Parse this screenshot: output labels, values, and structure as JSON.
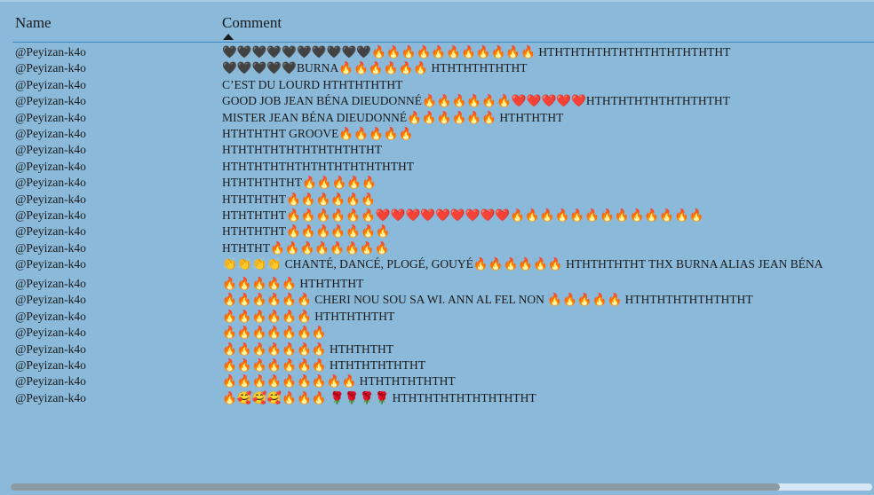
{
  "table": {
    "columns": {
      "name": "Name",
      "comment": "Comment"
    },
    "sort_indicator": "ascending",
    "rows": [
      {
        "name": "@Peyizan-k4o",
        "comment": "🖤🖤🖤🖤🖤🖤🖤🖤🖤🖤🔥🔥🔥🔥🔥🔥🔥🔥🔥🔥🔥 HTHTHTHTHTHTHTHTHTHTHTHT"
      },
      {
        "name": "@Peyizan-k4o",
        "comment": "🖤🖤🖤🖤🖤BURNA🔥🔥🔥🔥🔥🔥 HTHTHTHTHTHT"
      },
      {
        "name": "@Peyizan-k4o",
        "comment": "C’EST DU LOURD HTHTHTHTHT"
      },
      {
        "name": "@Peyizan-k4o",
        "comment": "GOOD JOB JEAN BÉNA DIEUDONNÉ🔥🔥🔥🔥🔥🔥❤️❤️❤️❤️❤️HTHTHTHTHTHTHTHTHT"
      },
      {
        "name": "@Peyizan-k4o",
        "comment": "MISTER JEAN BÉNA DIEUDONNÉ🔥🔥🔥🔥🔥🔥 HTHTHTHT"
      },
      {
        "name": "@Peyizan-k4o",
        "comment": "HTHTHTHT GROOVE🔥🔥🔥🔥🔥"
      },
      {
        "name": "@Peyizan-k4o",
        "comment": "HTHTHTHTHTHTHTHTHTHT"
      },
      {
        "name": "@Peyizan-k4o",
        "comment": "HTHTHTHTHTHTHTHTHTHTHTHT"
      },
      {
        "name": "@Peyizan-k4o",
        "comment": "HTHTHTHTHT🔥🔥🔥🔥🔥"
      },
      {
        "name": "@Peyizan-k4o",
        "comment": "HTHTHTHT🔥🔥🔥🔥🔥🔥"
      },
      {
        "name": "@Peyizan-k4o",
        "comment": "HTHTHTHT🔥🔥🔥🔥🔥🔥❤️❤️❤️❤️❤️❤️❤️❤️❤️🔥🔥🔥🔥🔥🔥🔥🔥🔥🔥🔥🔥🔥"
      },
      {
        "name": "@Peyizan-k4o",
        "comment": "HTHTHTHT🔥🔥🔥🔥🔥🔥🔥"
      },
      {
        "name": "@Peyizan-k4o",
        "comment": "HTHTHT🔥🔥🔥🔥🔥🔥🔥🔥"
      },
      {
        "name": "@Peyizan-k4o",
        "comment": "👏👏👏👏 CHANTÉ, DANCÉ, PLOGÉ, GOUYÉ🔥🔥🔥🔥🔥🔥 HTHTHTHTHT THX BURNA ALIAS JEAN BÉNA"
      },
      {
        "name": "@Peyizan-k4o",
        "comment": "🔥🔥🔥🔥🔥 HTHTHTHT"
      },
      {
        "name": "@Peyizan-k4o",
        "comment": "🔥🔥🔥🔥🔥🔥 CHERI NOU SOU SA WI. ANN AL FEL NON 🔥🔥🔥🔥🔥 HTHTHTHTHTHTHTHT"
      },
      {
        "name": "@Peyizan-k4o",
        "comment": "🔥🔥🔥🔥🔥🔥 HTHTHTHTHT"
      },
      {
        "name": "@Peyizan-k4o",
        "comment": "🔥🔥🔥🔥🔥🔥🔥"
      },
      {
        "name": "@Peyizan-k4o",
        "comment": "🔥🔥🔥🔥🔥🔥🔥 HTHTHTHT"
      },
      {
        "name": "@Peyizan-k4o",
        "comment": "🔥🔥🔥🔥🔥🔥🔥 HTHTHTHTHTHT"
      },
      {
        "name": "@Peyizan-k4o",
        "comment": "🔥🔥🔥🔥🔥🔥🔥🔥🔥 HTHTHTHTHTHT"
      },
      {
        "name": "@Peyizan-k4o",
        "comment": "🔥🥰🥰🥰🔥🔥🔥 🌹🌹🌹🌹 HTHTHTHTHTHTHTHTHT"
      }
    ]
  },
  "scrollbar": {
    "position_fraction": 0.0,
    "visible_fraction": 0.89
  }
}
